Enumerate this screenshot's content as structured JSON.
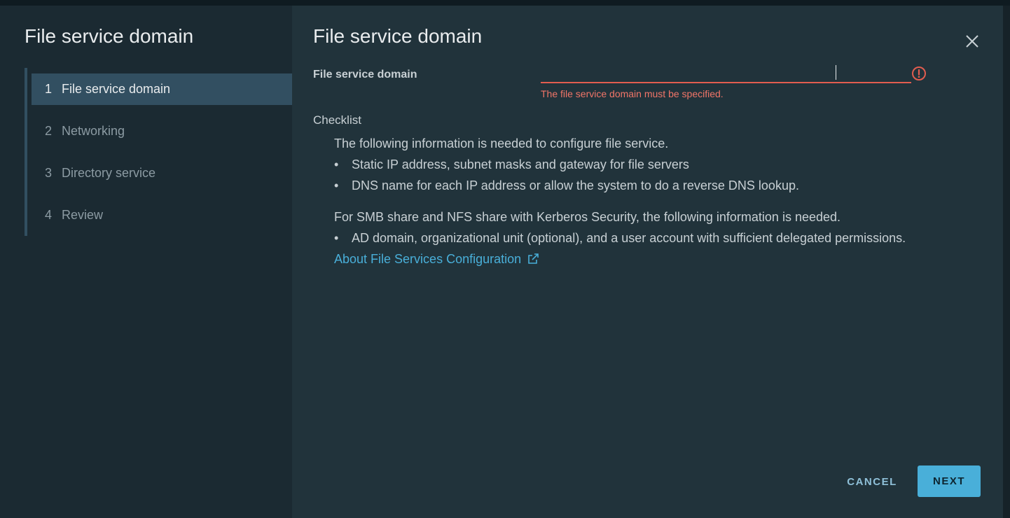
{
  "sidenav": {
    "title": "File service domain",
    "steps": [
      {
        "num": "1",
        "label": "File service domain",
        "active": true
      },
      {
        "num": "2",
        "label": "Networking",
        "active": false
      },
      {
        "num": "3",
        "label": "Directory service",
        "active": false
      },
      {
        "num": "4",
        "label": "Review",
        "active": false
      }
    ]
  },
  "content": {
    "title": "File service domain",
    "field": {
      "label": "File service domain",
      "value": "",
      "error": "The file service domain must be specified."
    },
    "checklist": {
      "title": "Checklist",
      "intro": "The following information is needed to configure file service.",
      "items": [
        "Static IP address, subnet masks and gateway for file servers",
        "DNS name for each IP address or allow the system to do a reverse DNS lookup."
      ],
      "smb_intro": "For SMB share and NFS share with Kerberos Security, the following information is needed.",
      "smb_items": [
        "AD domain, organizational unit (optional), and a user account with sufficient delegated permissions."
      ],
      "link": "About File Services Configuration"
    }
  },
  "footer": {
    "cancel_label": "CANCEL",
    "next_label": "NEXT"
  },
  "icons": {
    "close": "close-icon",
    "error": "error-circle-icon",
    "external_link": "external-link-icon"
  },
  "colors": {
    "accent": "#49afd9",
    "error": "#e25d4f",
    "sidenav_bg": "#1b2a32",
    "content_bg": "#21333b",
    "active_step_bg": "#324f61"
  }
}
